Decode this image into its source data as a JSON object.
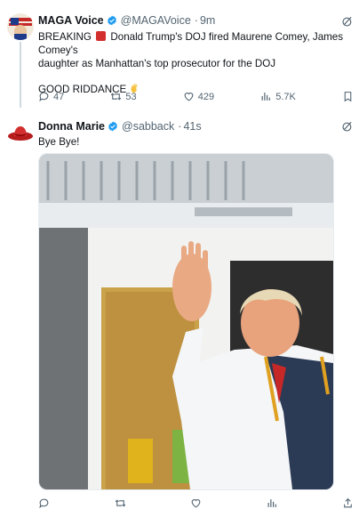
{
  "tweet1": {
    "display_name": "MAGA Voice",
    "handle": "@MAGAVoice",
    "time": "9m",
    "text_line1_pre": "BREAKING",
    "text_line1_post": "Donald Trump's DOJ fired Maurene Comey, James Comey's",
    "text_line2": "daughter as Manhattan's top prosecutor for the DOJ",
    "text_line3": "GOOD RIDDANCE",
    "replies": "47",
    "reposts": "53",
    "likes": "429",
    "views": "5.7K"
  },
  "tweet2": {
    "display_name": "Donna Marie",
    "handle": "@sabback",
    "time": "41s",
    "text": "Bye Bye!"
  },
  "colors": {
    "verified": "#1d9bf0",
    "muted": "#536471",
    "line": "#cfd9de"
  },
  "icons": [
    "verified-badge-icon",
    "grok-icon",
    "reply-icon",
    "repost-icon",
    "like-icon",
    "views-icon",
    "bookmark-icon",
    "share-icon"
  ]
}
